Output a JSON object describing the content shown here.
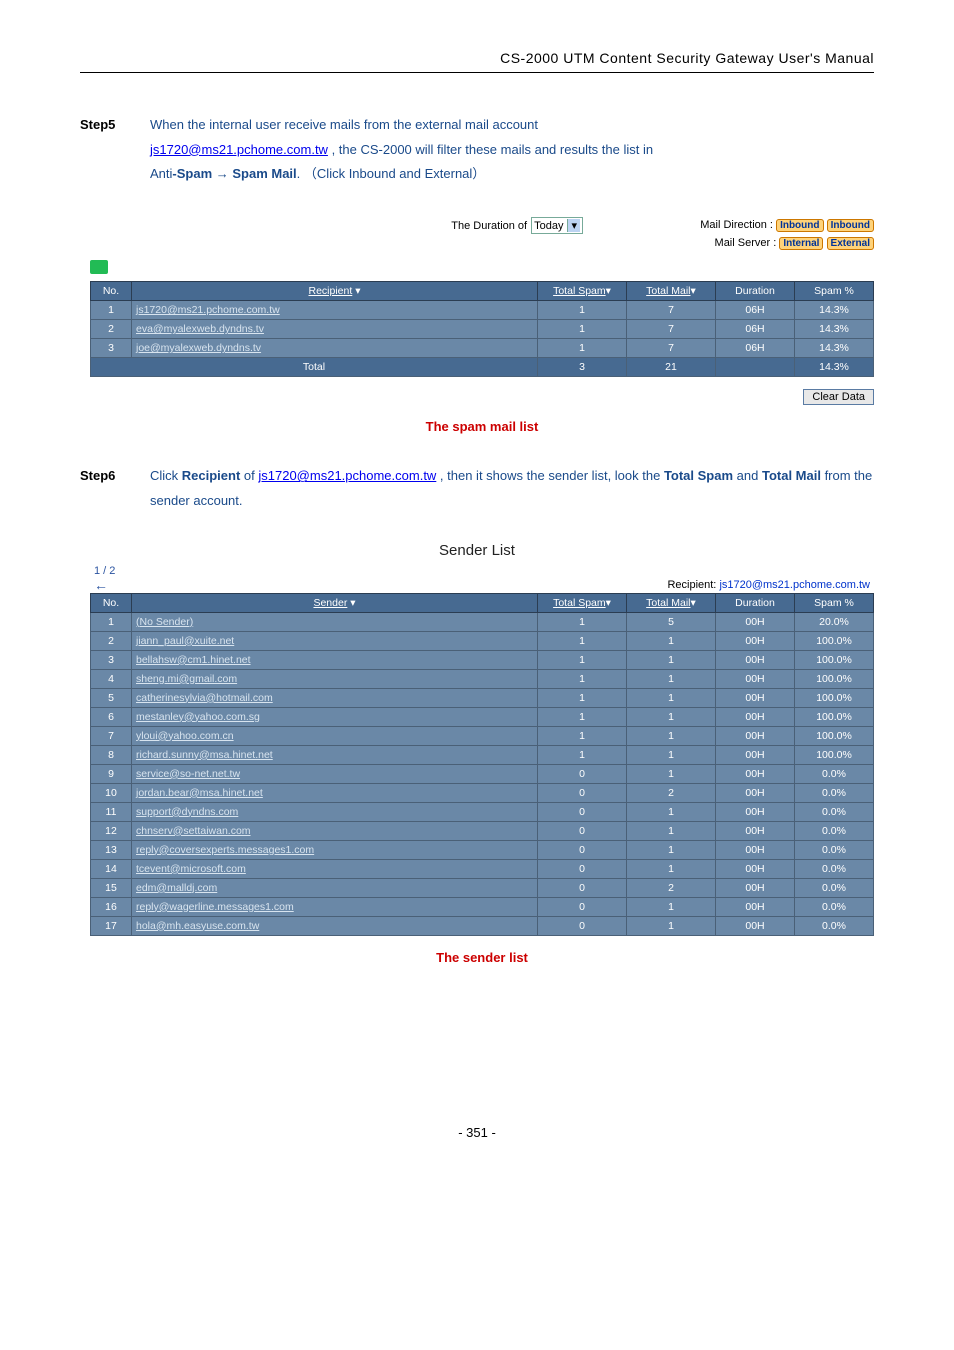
{
  "header": "CS-2000 UTM Content Security Gateway User's Manual",
  "step5": {
    "label": "Step5",
    "line1": "When the internal user receive mails from the external mail account ",
    "link": "js1720@ms21.pchome.com.tw",
    "line2a": " , the CS-2000 will filter these mails and results the list in ",
    "line2b": "Anti",
    "line2c": "-Spam ",
    "arrow": "→",
    "line2d": " Spam Mail",
    "line2e": ".",
    "paren": "（Click Inbound and External）"
  },
  "report1": {
    "duration_label": "The Duration of",
    "duration_value": "Today",
    "mail_direction_label": "Mail Direction :",
    "mail_server_label": "Mail Server :",
    "pill_inbound1": "Inbound",
    "pill_inbound2": "Inbound",
    "pill_internal": "Internal",
    "pill_external": "External",
    "headers": {
      "no": "No.",
      "recipient": "Recipient",
      "total_spam": "Total Spam",
      "total_mail": "Total Mail",
      "duration": "Duration",
      "spam_pct": "Spam %"
    },
    "rows": [
      {
        "no": "1",
        "recipient": "js1720@ms21.pchome.com.tw",
        "spam": "1",
        "mail": "7",
        "dur": "06H",
        "pct": "14.3%"
      },
      {
        "no": "2",
        "recipient": "eva@myalexweb.dyndns.tv",
        "spam": "1",
        "mail": "7",
        "dur": "06H",
        "pct": "14.3%"
      },
      {
        "no": "3",
        "recipient": "joe@myalexweb.dyndns.tv",
        "spam": "1",
        "mail": "7",
        "dur": "06H",
        "pct": "14.3%"
      }
    ],
    "total_label": "Total",
    "total": {
      "spam": "3",
      "mail": "21",
      "dur": "",
      "pct": "14.3%"
    },
    "clear": "Clear Data",
    "caption": "The spam mail list"
  },
  "step6": {
    "label": "Step6",
    "t1": "Click ",
    "b1": "Recipient",
    "t2": " of ",
    "link": "js1720@ms21.pchome.com.tw",
    "t3": " , then it shows the sender list, look the ",
    "b2": "Total Spam",
    "t4": " and ",
    "b3": "Total Mail",
    "t5": " from the sender account."
  },
  "senderlist": {
    "title": "Sender List",
    "pager": "1 / 2",
    "back": "←",
    "recip_label": "Recipient:  ",
    "recip_value": "js1720@ms21.pchome.com.tw",
    "headers": {
      "no": "No.",
      "sender": "Sender",
      "total_spam": "Total Spam",
      "total_mail": "Total Mail",
      "duration": "Duration",
      "spam_pct": "Spam %"
    },
    "rows": [
      {
        "no": "1",
        "sender": "(No Sender)",
        "spam": "1",
        "mail": "5",
        "dur": "00H",
        "pct": "20.0%"
      },
      {
        "no": "2",
        "sender": "jiann_paul@xuite.net",
        "spam": "1",
        "mail": "1",
        "dur": "00H",
        "pct": "100.0%"
      },
      {
        "no": "3",
        "sender": "bellahsw@cm1.hinet.net",
        "spam": "1",
        "mail": "1",
        "dur": "00H",
        "pct": "100.0%"
      },
      {
        "no": "4",
        "sender": "sheng.mi@gmail.com",
        "spam": "1",
        "mail": "1",
        "dur": "00H",
        "pct": "100.0%"
      },
      {
        "no": "5",
        "sender": "catherinesylvia@hotmail.com",
        "spam": "1",
        "mail": "1",
        "dur": "00H",
        "pct": "100.0%"
      },
      {
        "no": "6",
        "sender": "mestanley@yahoo.com.sg",
        "spam": "1",
        "mail": "1",
        "dur": "00H",
        "pct": "100.0%"
      },
      {
        "no": "7",
        "sender": "yloui@yahoo.com.cn",
        "spam": "1",
        "mail": "1",
        "dur": "00H",
        "pct": "100.0%"
      },
      {
        "no": "8",
        "sender": "richard.sunny@msa.hinet.net",
        "spam": "1",
        "mail": "1",
        "dur": "00H",
        "pct": "100.0%"
      },
      {
        "no": "9",
        "sender": "service@so-net.net.tw",
        "spam": "0",
        "mail": "1",
        "dur": "00H",
        "pct": "0.0%"
      },
      {
        "no": "10",
        "sender": "jordan.bear@msa.hinet.net",
        "spam": "0",
        "mail": "2",
        "dur": "00H",
        "pct": "0.0%"
      },
      {
        "no": "11",
        "sender": "support@dyndns.com",
        "spam": "0",
        "mail": "1",
        "dur": "00H",
        "pct": "0.0%"
      },
      {
        "no": "12",
        "sender": "chnserv@settaiwan.com",
        "spam": "0",
        "mail": "1",
        "dur": "00H",
        "pct": "0.0%"
      },
      {
        "no": "13",
        "sender": "reply@coversexperts.messages1.com",
        "spam": "0",
        "mail": "1",
        "dur": "00H",
        "pct": "0.0%"
      },
      {
        "no": "14",
        "sender": "tcevent@microsoft.com",
        "spam": "0",
        "mail": "1",
        "dur": "00H",
        "pct": "0.0%"
      },
      {
        "no": "15",
        "sender": "edm@malldj.com",
        "spam": "0",
        "mail": "2",
        "dur": "00H",
        "pct": "0.0%"
      },
      {
        "no": "16",
        "sender": "reply@wagerline.messages1.com",
        "spam": "0",
        "mail": "1",
        "dur": "00H",
        "pct": "0.0%"
      },
      {
        "no": "17",
        "sender": "hola@mh.easyuse.com.tw",
        "spam": "0",
        "mail": "1",
        "dur": "00H",
        "pct": "0.0%"
      }
    ],
    "caption": "The sender list"
  },
  "footer": "- 351 -"
}
